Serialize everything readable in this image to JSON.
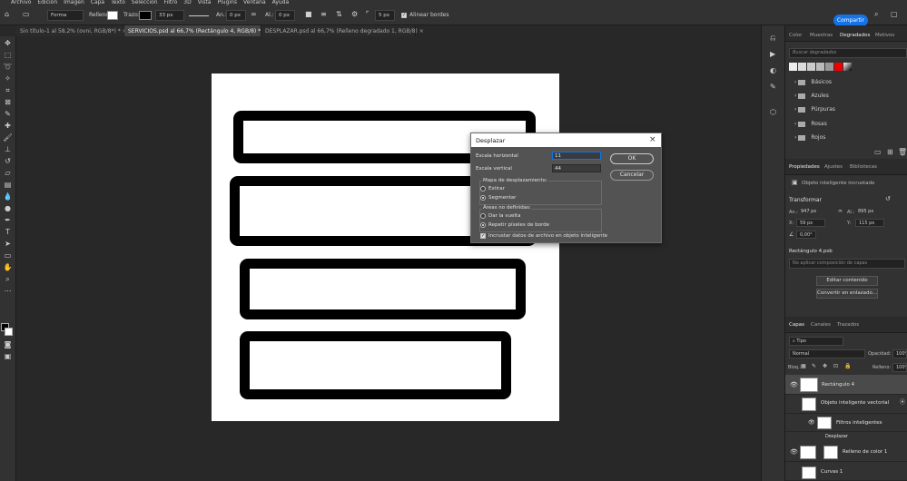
{
  "menubar": {
    "items": [
      "Archivo",
      "Edición",
      "Imagen",
      "Capa",
      "Texto",
      "Selección",
      "Filtro",
      "3D",
      "Vista",
      "Plugins",
      "Ventana",
      "Ayuda"
    ]
  },
  "options": {
    "mode": "Forma",
    "fill_label": "Relleno:",
    "stroke_label": "Trazo:",
    "stroke_size": "33 px",
    "width_label": "An.:",
    "width_value": "0 px",
    "height_label": "Al.:",
    "height_value": "0 px",
    "radius_value": "5 px",
    "align_edges": "Alinear bordes",
    "share": "Compartir"
  },
  "tabs": [
    {
      "label": "Sin título-1 al 58,2% (ovni, RGB/8*) *"
    },
    {
      "label": "SERVICIOS.psd al 66,7% (Rectángulo 4, RGB/8) *"
    },
    {
      "label": "DESPLAZAR.psd al 66,7% (Relleno degradado 1, RGB/8)"
    }
  ],
  "dialog": {
    "title": "Desplazar",
    "h_scale_label": "Escala horizontal",
    "h_scale_value": "11",
    "v_scale_label": "Escala vertical",
    "v_scale_value": "44",
    "map_group": "Mapa de desplazamiento:",
    "map_opt1": "Estirar",
    "map_opt2": "Segmentar",
    "undef_group": "Áreas no definidas:",
    "undef_opt1": "Dar la vuelta",
    "undef_opt2": "Repetir píxeles de borde",
    "embed": "Incrustar datos de archivo en objeto inteligente",
    "ok": "OK",
    "cancel": "Cancelar"
  },
  "gradients_panel": {
    "tabs": [
      "Color",
      "Muestras",
      "Degradados",
      "Motivos"
    ],
    "search_placeholder": "Buscar degradados",
    "folders": [
      "Básicos",
      "Azules",
      "Púrpuras",
      "Rosas",
      "Rojos"
    ]
  },
  "properties": {
    "tabs": [
      "Propiedades",
      "Ajustes",
      "Bibliotecas"
    ],
    "object_type": "Objeto inteligente incrustado",
    "transform": "Transformar",
    "w_label": "An.:",
    "w_value": "947 px",
    "h_label": "Al.:",
    "h_value": "895 px",
    "x_label": "X:",
    "x_value": "59 px",
    "y_label": "Y:",
    "y_value": "115 px",
    "angle_value": "0,00°",
    "file_name": "Rectángulo 4.psb",
    "layer_comp": "No aplicar composición de capas",
    "edit_contents": "Editar contenido",
    "convert_linked": "Convertir en enlazado..."
  },
  "layers_panel": {
    "tabs": [
      "Capas",
      "Canales",
      "Trazados"
    ],
    "filter_kind": "Tipo",
    "blend_mode": "Normal",
    "opacity_label": "Opacidad:",
    "opacity_value": "100%",
    "lock_label": "Bloq.:",
    "fill_label": "Relleno:",
    "fill_value": "100%",
    "layers": [
      {
        "name": "Rectángulo 4"
      },
      {
        "name": "Objeto inteligente vectorial"
      },
      {
        "name": "Filtros inteligentes"
      },
      {
        "name": "Desplazar"
      },
      {
        "name": "Relleno de color 1"
      },
      {
        "name": "Curvas 1"
      }
    ]
  },
  "colors": {
    "accent": "#1473e6",
    "panel": "#323232",
    "canvas_bg": "#282828"
  }
}
